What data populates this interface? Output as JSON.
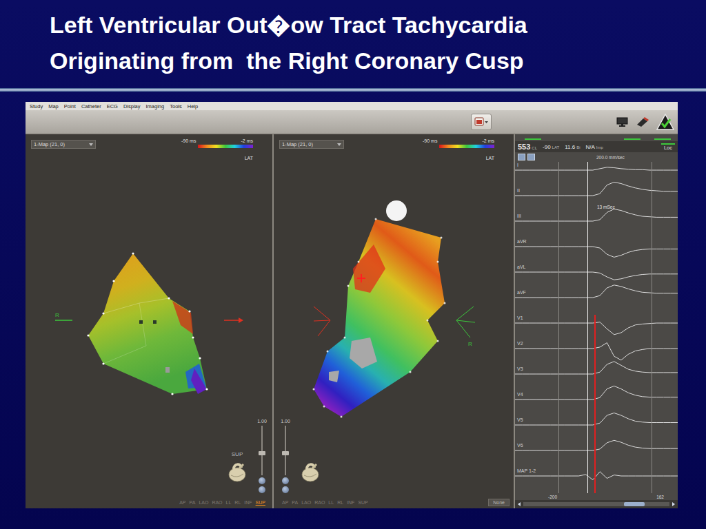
{
  "slide": {
    "title_lines": [
      "Left Ventricular Out�ow Tract Tachycardia",
      "Originating from  the Right Coronary Cusp"
    ]
  },
  "menu": [
    "Study",
    "Map",
    "Point",
    "Catheter",
    "ECG",
    "Display",
    "Imaging",
    "Tools",
    "Help"
  ],
  "maps": [
    {
      "kind": "superior",
      "map_select": "1-Map (21, 0)",
      "scale_min": "-90 ms",
      "scale_max": "-2 ms",
      "scale_label": "LAT",
      "axis_label": "R",
      "zoom": "1.00",
      "zoom_level": 0.45,
      "orientation_label": "SUP",
      "views": [
        {
          "label": "AP",
          "selected": false
        },
        {
          "label": "PA",
          "selected": false
        },
        {
          "label": "LAO",
          "selected": false
        },
        {
          "label": "RAO",
          "selected": false
        },
        {
          "label": "LL",
          "selected": false
        },
        {
          "label": "RL",
          "selected": false
        },
        {
          "label": "INF",
          "selected": false
        },
        {
          "label": "SUP",
          "selected": true
        }
      ]
    },
    {
      "kind": "oblique",
      "map_select": "1-Map (21, 0)",
      "scale_min": "-90 ms",
      "scale_max": "-2 ms",
      "scale_label": "LAT",
      "axis_label": "R",
      "zoom": "1.00",
      "zoom_level": 0.45,
      "views": [
        {
          "label": "AP",
          "selected": false
        },
        {
          "label": "PA",
          "selected": false
        },
        {
          "label": "LAO",
          "selected": false
        },
        {
          "label": "RAO",
          "selected": false
        },
        {
          "label": "LL",
          "selected": false
        },
        {
          "label": "RL",
          "selected": false
        },
        {
          "label": "INF",
          "selected": false
        },
        {
          "label": "SUP",
          "selected": false
        }
      ],
      "layer_select": "None"
    }
  ],
  "ecg": {
    "readouts": [
      {
        "value": "553",
        "unit": "CL"
      },
      {
        "value": "-90",
        "unit": "LAT"
      },
      {
        "value": "11.6",
        "unit": "Bi"
      },
      {
        "value": "N/A",
        "unit": "Imp"
      }
    ],
    "loc_button": "Loc",
    "sweep": "200.0 mm/sec",
    "annotation": "13 mSec",
    "window_start": "-200",
    "window_end": "162",
    "scroll_position": 0.8,
    "leads": [
      {
        "name": "I",
        "values": [
          0,
          0,
          0,
          0,
          0,
          0,
          0,
          0,
          0,
          0,
          0,
          0,
          0.3,
          0.6,
          0.5,
          0.3,
          0.2,
          0.1,
          0.1,
          0,
          0,
          0,
          0,
          0
        ]
      },
      {
        "name": "II",
        "values": [
          0,
          0,
          0,
          0,
          0,
          0,
          0,
          0,
          0,
          0,
          0,
          0,
          0.4,
          2.2,
          2.8,
          2.5,
          2.0,
          1.6,
          1.3,
          1.1,
          1.0,
          0.9,
          0.9,
          0.9
        ]
      },
      {
        "name": "III",
        "values": [
          0,
          0,
          0,
          0,
          0,
          0,
          0,
          0,
          0,
          0,
          0,
          0,
          0.3,
          1.8,
          2.5,
          2.2,
          1.7,
          1.3,
          1.0,
          0.9,
          0.8,
          0.8,
          0.8,
          0.8
        ]
      },
      {
        "name": "aVR",
        "values": [
          0,
          0,
          0,
          0,
          0,
          0,
          0,
          0,
          0,
          0,
          0,
          0,
          -0.3,
          -1.6,
          -2.2,
          -1.8,
          -1.2,
          -0.8,
          -0.6,
          -0.5,
          -0.5,
          -0.5,
          -0.5,
          -0.5
        ]
      },
      {
        "name": "aVL",
        "values": [
          0,
          0,
          0,
          0,
          0,
          0,
          0,
          0,
          0,
          0,
          0,
          0,
          -0.2,
          -1.0,
          -1.6,
          -1.4,
          -1.0,
          -0.7,
          -0.5,
          -0.4,
          -0.4,
          -0.4,
          -0.4,
          -0.4
        ]
      },
      {
        "name": "aVF",
        "values": [
          0,
          0,
          0,
          0,
          0,
          0,
          0,
          0,
          0,
          0,
          0,
          0,
          0.4,
          2.0,
          2.6,
          2.3,
          1.8,
          1.4,
          1.1,
          1.0,
          0.9,
          0.9,
          0.9,
          0.9
        ]
      },
      {
        "name": "V1",
        "values": [
          0,
          0,
          0,
          0,
          0,
          0,
          0,
          0,
          0,
          0,
          0,
          0,
          0.2,
          -1.2,
          -2.4,
          -2.0,
          -1.0,
          -0.4,
          -0.2,
          -0.1,
          0,
          0,
          0,
          0
        ]
      },
      {
        "name": "V2",
        "values": [
          0,
          0,
          0,
          0,
          0,
          0,
          0,
          0,
          0,
          0,
          0,
          0,
          0.3,
          1.2,
          -1.6,
          -2.4,
          -1.2,
          -0.5,
          -0.2,
          0,
          0,
          0,
          0,
          0
        ]
      },
      {
        "name": "V3",
        "values": [
          0,
          0,
          0,
          0,
          0,
          0,
          0,
          0,
          0,
          0,
          0,
          0,
          0.4,
          2.0,
          2.6,
          1.8,
          1.0,
          0.6,
          0.4,
          0.3,
          0.3,
          0.3,
          0.3,
          0.3
        ]
      },
      {
        "name": "V4",
        "values": [
          0,
          0,
          0,
          0,
          0,
          0,
          0,
          0,
          0,
          0,
          0,
          0,
          0.4,
          2.2,
          2.8,
          2.2,
          1.4,
          0.9,
          0.6,
          0.5,
          0.5,
          0.5,
          0.5,
          0.5
        ]
      },
      {
        "name": "V5",
        "values": [
          0,
          0,
          0,
          0,
          0,
          0,
          0,
          0,
          0,
          0,
          0,
          0,
          0.4,
          2.0,
          2.5,
          2.0,
          1.3,
          0.8,
          0.6,
          0.5,
          0.5,
          0.5,
          0.5,
          0.5
        ]
      },
      {
        "name": "V6",
        "values": [
          0,
          0,
          0,
          0,
          0,
          0,
          0,
          0,
          0,
          0,
          0,
          0,
          0.3,
          1.6,
          2.1,
          1.7,
          1.1,
          0.7,
          0.5,
          0.4,
          0.4,
          0.4,
          0.4,
          0.4
        ]
      },
      {
        "name": "MAP 1-2",
        "values": [
          0,
          0,
          0,
          0,
          0,
          0,
          0,
          0,
          0,
          0,
          0.3,
          -0.8,
          0.9,
          -0.5,
          0.2,
          0,
          0,
          0,
          0,
          0,
          0,
          0,
          0,
          0
        ]
      }
    ]
  }
}
